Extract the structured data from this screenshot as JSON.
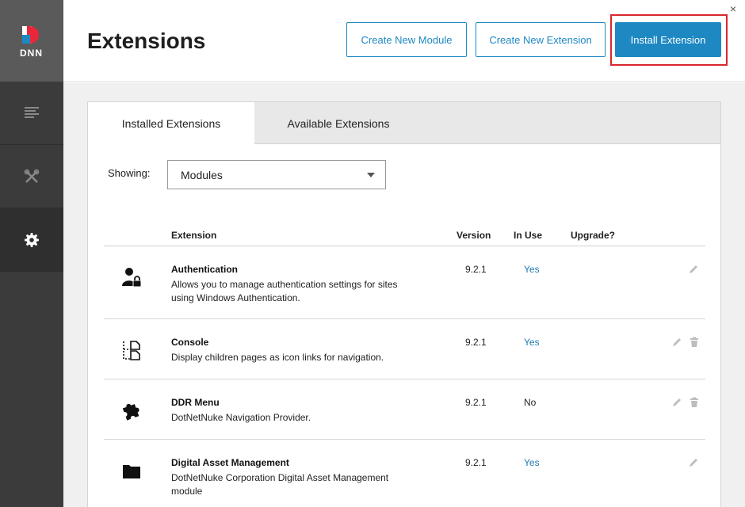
{
  "sidebar": {
    "logo_text": "DNN",
    "items": [
      {
        "name": "pages-icon"
      },
      {
        "name": "tools-icon"
      },
      {
        "name": "settings-icon"
      }
    ]
  },
  "header": {
    "title": "Extensions",
    "create_module_label": "Create New Module",
    "create_extension_label": "Create New Extension",
    "install_extension_label": "Install Extension",
    "close_label": "×"
  },
  "tabs": {
    "installed": "Installed Extensions",
    "available": "Available Extensions"
  },
  "filter": {
    "label": "Showing:",
    "value": "Modules"
  },
  "table": {
    "columns": {
      "extension": "Extension",
      "version": "Version",
      "in_use": "In Use",
      "upgrade": "Upgrade?"
    },
    "rows": [
      {
        "icon": "user-lock-icon",
        "name": "Authentication",
        "description": "Allows you to manage authentication settings for sites using Windows Authentication.",
        "version": "9.2.1",
        "in_use": "Yes"
      },
      {
        "icon": "console-icon",
        "name": "Console",
        "description": "Display children pages as icon links for navigation.",
        "version": "9.2.1",
        "in_use": "Yes"
      },
      {
        "icon": "puzzle-icon",
        "name": "DDR Menu",
        "description": "DotNetNuke Navigation Provider.",
        "version": "9.2.1",
        "in_use": "No"
      },
      {
        "icon": "folder-icon",
        "name": "Digital Asset Management",
        "description": "DotNetNuke Corporation Digital Asset Management module",
        "version": "9.2.1",
        "in_use": "Yes"
      }
    ]
  },
  "colors": {
    "accent": "#1e88c3",
    "highlight": "#d9272d",
    "sidebar": "#3b3b3b"
  }
}
